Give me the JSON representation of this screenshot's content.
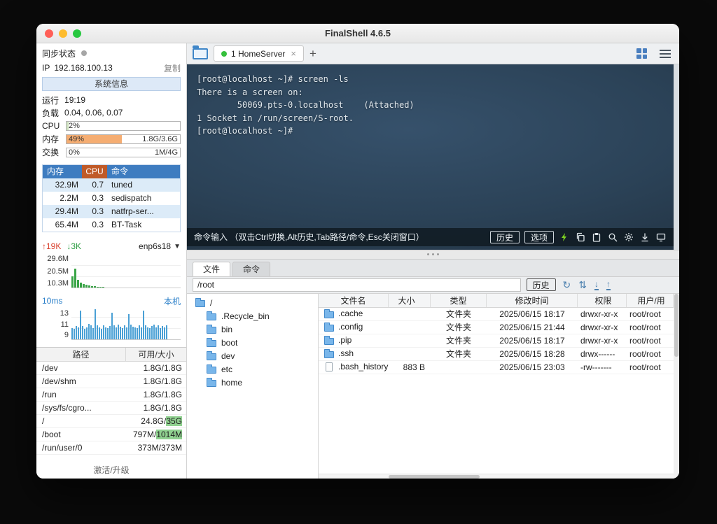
{
  "window": {
    "title": "FinalShell 4.6.5"
  },
  "sidebar": {
    "sync_label": "同步状态",
    "ip_label": "IP",
    "ip_value": "192.168.100.13",
    "copy_label": "复制",
    "sysinfo_label": "系统信息",
    "uptime_label": "运行",
    "uptime_value": "19:19",
    "load_label": "负载",
    "load_value": "0.04, 0.06, 0.07",
    "meters": {
      "cpu": {
        "label": "CPU",
        "percent": "2%",
        "value": "",
        "pct": 2
      },
      "mem": {
        "label": "内存",
        "percent": "49%",
        "value": "1.8G/3.6G",
        "pct": 49
      },
      "swap": {
        "label": "交换",
        "percent": "0%",
        "value": "1M/4G",
        "pct": 0
      }
    },
    "process_table": {
      "headers": [
        "内存",
        "CPU",
        "命令"
      ],
      "rows": [
        {
          "mem": "32.9M",
          "cpu": "0.7",
          "cmd": "tuned"
        },
        {
          "mem": "2.2M",
          "cpu": "0.3",
          "cmd": "sedispatch"
        },
        {
          "mem": "29.4M",
          "cpu": "0.3",
          "cmd": "natfrp-ser..."
        },
        {
          "mem": "65.4M",
          "cpu": "0.3",
          "cmd": "BT-Task"
        }
      ]
    },
    "network": {
      "up": "19K",
      "down": "3K",
      "iface": "enp6s18",
      "y_labels": [
        "29.6M",
        "20.5M",
        "10.3M"
      ],
      "bars": [
        34,
        58,
        24,
        14,
        10,
        8,
        6,
        5,
        4,
        3,
        2,
        2
      ]
    },
    "ping": {
      "latency": "10ms",
      "target": "本机",
      "y_labels": [
        "13",
        "11",
        "9"
      ],
      "bars": [
        38,
        34,
        44,
        40,
        95,
        44,
        36,
        40,
        52,
        46,
        38,
        100,
        46,
        40,
        36,
        46,
        40,
        38,
        44,
        88,
        46,
        40,
        48,
        42,
        38,
        46,
        40,
        84,
        48,
        42,
        40,
        38,
        46,
        40,
        96,
        46,
        40,
        38,
        44,
        48,
        40,
        46,
        38,
        44,
        40,
        46
      ]
    },
    "disk_table": {
      "headers": [
        "路径",
        "可用/大小"
      ],
      "rows": [
        {
          "path": "/dev",
          "value": "1.8G/1.8G",
          "highlight": ""
        },
        {
          "path": "/dev/shm",
          "value": "1.8G/1.8G",
          "highlight": ""
        },
        {
          "path": "/run",
          "value": "1.8G/1.8G",
          "highlight": ""
        },
        {
          "path": "/sys/fs/cgro...",
          "value": "1.8G/1.8G",
          "highlight": ""
        },
        {
          "path": "/",
          "value": "24.8G/",
          "highlight": "35G"
        },
        {
          "path": "/boot",
          "value": "797M/",
          "highlight": "1014M"
        },
        {
          "path": "/run/user/0",
          "value": "373M/373M",
          "highlight": ""
        }
      ]
    },
    "activate_label": "激活/升级"
  },
  "tabbar": {
    "tab_title": "1 HomeServer",
    "tab_close": "×",
    "add_label": "+"
  },
  "terminal": {
    "lines": [
      "[root@localhost ~]# screen -ls",
      "There is a screen on:",
      "        50069.pts-0.localhost    (Attached)",
      "1 Socket in /run/screen/S-root.",
      "[root@localhost ~]# "
    ],
    "cmdbar": {
      "hint": "命令输入 （双击Ctrl切换,Alt历史,Tab路径/命令,Esc关闭窗口）",
      "history_label": "历史",
      "options_label": "选项"
    }
  },
  "bottom": {
    "tabs": {
      "files": "文件",
      "commands": "命令"
    },
    "path_value": "/root",
    "history_label": "历史",
    "tree": {
      "root": "/",
      "items": [
        ".Recycle_bin",
        "bin",
        "boot",
        "dev",
        "etc",
        "home"
      ]
    },
    "file_table": {
      "headers": [
        "文件名",
        "大小",
        "类型",
        "修改时间",
        "权限",
        "用户/用"
      ],
      "rows": [
        {
          "name": ".cache",
          "size": "",
          "type": "文件夹",
          "mtime": "2025/06/15 18:17",
          "perm": "drwxr-xr-x",
          "owner": "root/root"
        },
        {
          "name": ".config",
          "size": "",
          "type": "文件夹",
          "mtime": "2025/06/15 21:44",
          "perm": "drwxr-xr-x",
          "owner": "root/root"
        },
        {
          "name": ".pip",
          "size": "",
          "type": "文件夹",
          "mtime": "2025/06/15 18:17",
          "perm": "drwxr-xr-x",
          "owner": "root/root"
        },
        {
          "name": ".ssh",
          "size": "",
          "type": "文件夹",
          "mtime": "2025/06/15 18:28",
          "perm": "drwx------",
          "owner": "root/root"
        },
        {
          "name": ".bash_history",
          "size": "883 B",
          "type": "",
          "mtime": "2025/06/15 23:03",
          "perm": "-rw-------",
          "owner": "root/root"
        }
      ]
    }
  }
}
